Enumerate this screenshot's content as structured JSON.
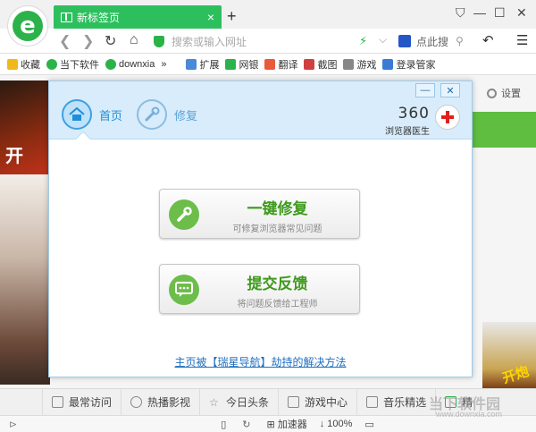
{
  "browser": {
    "tab_title": "新标签页",
    "tab_close": "×",
    "new_tab": "+",
    "address_placeholder": "搜索或输入网址",
    "search_placeholder": "点此搜",
    "window_controls": [
      "⛉",
      "—",
      "☐",
      "✕"
    ]
  },
  "bookmarks": [
    {
      "label": "收藏",
      "icon": "star-icon",
      "color": "#f1b81b"
    },
    {
      "label": "当下软件",
      "icon": "d-icon",
      "color": "#2bb34a"
    },
    {
      "label": "downxia",
      "icon": "d-icon",
      "color": "#2bb34a"
    },
    {
      "label": "»",
      "icon": "",
      "color": ""
    },
    {
      "label": "扩展",
      "icon": "grid-icon",
      "color": "#4a8ad6"
    },
    {
      "label": "网银",
      "icon": "shield-icon",
      "color": "#2bb34a"
    },
    {
      "label": "翻译",
      "icon": "translate-icon",
      "color": "#e85a3a"
    },
    {
      "label": "截图",
      "icon": "scissors-icon",
      "color": "#d04040"
    },
    {
      "label": "游戏",
      "icon": "gamepad-icon",
      "color": "#888888"
    },
    {
      "label": "登录管家",
      "icon": "user-icon",
      "color": "#3a7bd5"
    }
  ],
  "page": {
    "settings_label": "设置",
    "banner_text": "开",
    "ad_text": "开炮"
  },
  "dialog": {
    "tab_home": "首页",
    "tab_repair": "修复",
    "brand_number": "360",
    "brand_name": "浏览器医生",
    "minimize": "—",
    "close": "✕",
    "repair_button": {
      "title": "一键修复",
      "subtitle": "可修复浏览器常见问题"
    },
    "feedback_button": {
      "title": "提交反馈",
      "subtitle": "将问题反馈给工程师"
    },
    "hijack_link": "主页被【瑞星导航】劫持的解决方法"
  },
  "bottom_bar": [
    {
      "label": "最常访问",
      "icon": "list-icon"
    },
    {
      "label": "热播影视",
      "icon": "play-icon"
    },
    {
      "label": "今日头条",
      "icon": "star-icon"
    },
    {
      "label": "游戏中心",
      "icon": "gamepad-icon"
    },
    {
      "label": "音乐精选",
      "icon": "music-icon"
    },
    {
      "label": "精",
      "icon": "lock-icon"
    }
  ],
  "status_bar": {
    "accelerator": "加速器",
    "zoom": "100%"
  },
  "watermark": {
    "line1": "当下软件园",
    "line2": "www.downxia.com"
  },
  "colors": {
    "brand_green": "#2bb34a",
    "dialog_blue": "#d8ecfb",
    "link_blue": "#1f6fc0",
    "button_green_text": "#3e9a1c"
  }
}
